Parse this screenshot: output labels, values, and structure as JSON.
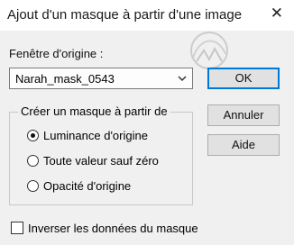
{
  "window": {
    "title": "Ajout d'un masque à partir d'une image",
    "close_glyph": "✕"
  },
  "source": {
    "label": "Fenêtre d'origine :",
    "selected": "Narah_mask_0543"
  },
  "create_group": {
    "title": "Créer un masque à partir de",
    "options": [
      {
        "label": "Luminance d'origine",
        "selected": true
      },
      {
        "label": "Toute valeur sauf zéro",
        "selected": false
      },
      {
        "label": "Opacité d'origine",
        "selected": false
      }
    ]
  },
  "invert": {
    "label": "Inverser les données du masque",
    "checked": false
  },
  "buttons": {
    "ok": "OK",
    "cancel": "Annuler",
    "help": "Aide"
  },
  "icons": {
    "close": "close-icon",
    "dropdown": "chevron-down-icon",
    "radio_selected": "radio-selected-icon",
    "radio_unselected": "radio-unselected-icon",
    "checkbox": "checkbox-icon",
    "watermark": "watermark-logo"
  },
  "colors": {
    "dialog_bg": "#f0f0f0",
    "titlebar_bg": "#ffffff",
    "button_bg": "#e1e1e1",
    "focus_accent": "#0078d7"
  }
}
